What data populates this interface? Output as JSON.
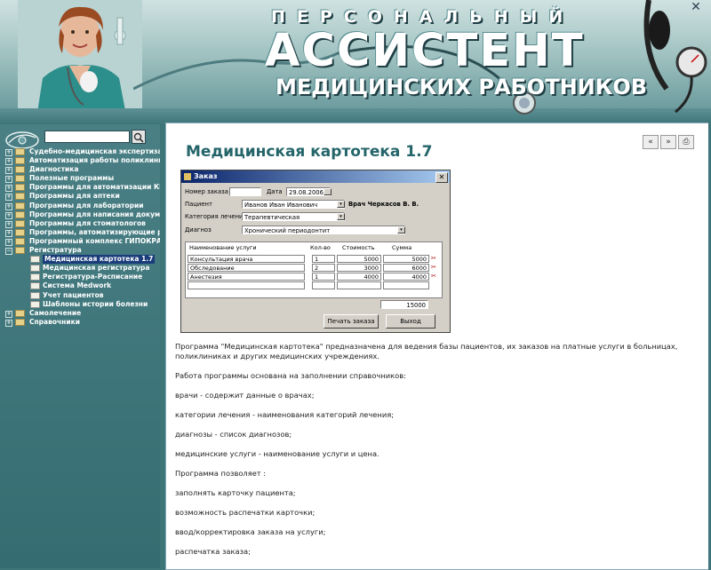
{
  "header": {
    "title_line1": "ПЕРСОНАЛЬНЫЙ",
    "title_line2": "АССИСТЕНТ",
    "title_line3": "МЕДИЦИНСКИХ РАБОТНИКОВ",
    "close_glyph": "✕"
  },
  "sidebar": {
    "search": {
      "value": "",
      "placeholder": ""
    },
    "items": [
      {
        "label": "Судебно-медицинская экспертиза",
        "expander": "+"
      },
      {
        "label": "Автоматизация работы поликлиники",
        "expander": "+"
      },
      {
        "label": "Диагностика",
        "expander": "+"
      },
      {
        "label": "Полезные программы",
        "expander": "+"
      },
      {
        "label": "Программы для автоматизации КВД",
        "expander": "+"
      },
      {
        "label": "Программы для аптеки",
        "expander": "+"
      },
      {
        "label": "Программы для лаборатории",
        "expander": "+"
      },
      {
        "label": "Программы для написания документа",
        "expander": "+"
      },
      {
        "label": "Программы для стоматологов",
        "expander": "+"
      },
      {
        "label": "Программы, автоматизирующие рабо",
        "expander": "+"
      },
      {
        "label": "Программный комплекс ГИПОКРАТ",
        "expander": "+"
      },
      {
        "label": "Регистратура",
        "expander": "−"
      }
    ],
    "subitems": [
      {
        "label": "Медицинская картотека 1.7",
        "selected": true
      },
      {
        "label": "Медицинская регистратура",
        "selected": false
      },
      {
        "label": "Регистратура-Расписание",
        "selected": false
      },
      {
        "label": "Система Medwork",
        "selected": false
      },
      {
        "label": "Учет пациентов",
        "selected": false
      },
      {
        "label": "Шаблоны истории болезни",
        "selected": false
      }
    ],
    "items_after": [
      {
        "label": "Самолечение",
        "expander": "+"
      },
      {
        "label": "Справочники",
        "expander": "+"
      }
    ]
  },
  "main": {
    "title": "Медицинская картотека 1.7",
    "nav": {
      "back": "«",
      "forward": "»",
      "print": "⎙"
    }
  },
  "dialog": {
    "title": "Заказ",
    "order_number_label": "Номер заказа",
    "order_number_value": "",
    "date_label": "Дата",
    "date_value": "29.08.2006",
    "patient_label": "Пациент",
    "patient_value": "Иванов Иван Иванович",
    "doctor_label": "Врач Черкасов В. В.",
    "category_label": "Категория лечения",
    "category_value": "Терапевтическая",
    "diagnosis_label": "Диагноз",
    "diagnosis_value": "Хронический периодонтит",
    "columns": [
      "Наименование услуги",
      "Кол-во",
      "Стоимость",
      "Сумма"
    ],
    "rows": [
      {
        "service": "Консультация врача",
        "qty": "1",
        "price": "5000",
        "sum": "5000"
      },
      {
        "service": "Обследование",
        "qty": "2",
        "price": "3000",
        "sum": "6000"
      },
      {
        "service": "Анестезия",
        "qty": "1",
        "price": "4000",
        "sum": "4000"
      },
      {
        "service": "",
        "qty": "",
        "price": "",
        "sum": ""
      }
    ],
    "total": "15000",
    "print_button": "Печать заказа",
    "exit_button": "Выход"
  },
  "description": [
    "Программа \"Медицинская картотека\" предназначена для ведения базы пациентов, их заказов на платные услуги в больницах, поликлиниках и других медицинских учреждениях.",
    "Работа программы основана на заполнении справочников:",
    "врачи - содержит данные о врачах;",
    "категории лечения - наименования категорий лечения;",
    "диагнозы - список диагнозов;",
    "медицинские услуги - наименование услуги и цена.",
    "Программа позволяет :",
    "заполнять карточку пациента;",
    "возможность распечатки карточки;",
    "ввод/корректировка заказа на услуги;",
    "распечатка заказа;"
  ],
  "colors": {
    "teal": "#3d7579",
    "title": "#24656a",
    "selected": "#1a3c7a"
  }
}
